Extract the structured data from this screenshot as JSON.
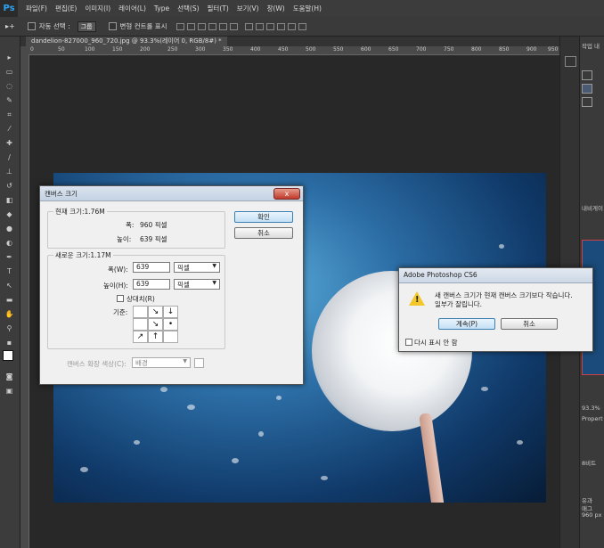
{
  "app": {
    "logo": "Ps",
    "menu": [
      "파일(F)",
      "편집(E)",
      "이미지(I)",
      "레이어(L)",
      "Type",
      "선택(S)",
      "필터(T)",
      "보기(V)",
      "창(W)",
      "도움말(H)"
    ]
  },
  "options_bar": {
    "auto_select_label": "자동 선택 :",
    "auto_select_value": "그룹",
    "transform_controls_label": "변형 컨트롤 표시"
  },
  "document": {
    "tab_label": "dandelion-827000_960_720.jpg @ 93.3%(레이어 0, RGB/8#) *",
    "ruler_ticks": [
      "0",
      "50",
      "100",
      "150",
      "200",
      "250",
      "300",
      "350",
      "400",
      "450",
      "500",
      "550",
      "600",
      "650",
      "700",
      "750",
      "800",
      "850",
      "900",
      "950"
    ]
  },
  "right_panel": {
    "tabs": [
      "작업 내",
      "내비게이",
      "Propert",
      "8비트"
    ],
    "zoom": "93.3%",
    "info_lines": [
      "유과",
      "매그",
      "960 px"
    ]
  },
  "canvas_size_dialog": {
    "title": "캔버스 크기",
    "current_size_label": "현재 크기:1.76M",
    "current_width_label": "폭:",
    "current_width_value": "960 픽셀",
    "current_height_label": "높이:",
    "current_height_value": "639 픽셀",
    "new_size_label": "새로운 크기:1.17M",
    "new_width_label": "폭(W):",
    "new_width_value": "639",
    "new_width_unit": "픽셀",
    "new_height_label": "높이(H):",
    "new_height_value": "639",
    "new_height_unit": "픽셀",
    "relative_label": "상대치(R)",
    "anchor_label": "기준:",
    "extension_color_label": "캔버스 확장 색상(C):",
    "extension_color_value": "배경",
    "ok_label": "확인",
    "cancel_label": "취소",
    "close_glyph": "x"
  },
  "warning_dialog": {
    "title": "Adobe Photoshop CS6",
    "message_line1": "새 캔버스 크기가 현재 캔버스 크기보다 작습니다.",
    "message_line2": "일부가 잘립니다.",
    "continue_label": "계속(P)",
    "cancel_label": "취소",
    "dont_show_label": "다시 표시 안 함"
  },
  "anchor_arrows": [
    "",
    "↘",
    "↓",
    "",
    "↘",
    "•",
    "↗",
    "↑",
    ""
  ]
}
